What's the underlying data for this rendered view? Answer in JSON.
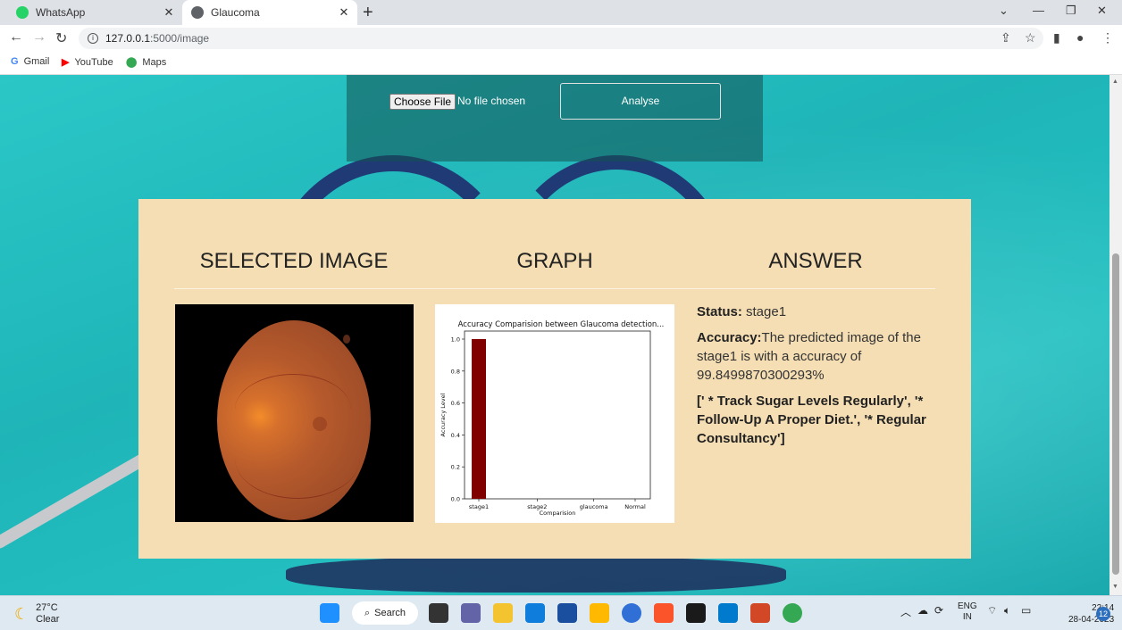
{
  "browser": {
    "tabs": [
      {
        "title": "WhatsApp",
        "icon": "whatsapp-icon",
        "active": false
      },
      {
        "title": "Glaucoma",
        "icon": "globe-icon",
        "active": true
      }
    ],
    "url_host": "127.0.0.1",
    "url_path": ":5000/image",
    "bookmarks": [
      {
        "label": "Gmail",
        "icon": "gmail-icon"
      },
      {
        "label": "YouTube",
        "icon": "youtube-icon"
      },
      {
        "label": "Maps",
        "icon": "maps-icon"
      }
    ]
  },
  "upload": {
    "choose_label": "Choose File",
    "file_status": "No file chosen",
    "analyse_label": "Analyse"
  },
  "results": {
    "col1_heading": "SELECTED IMAGE",
    "col2_heading": "GRAPH",
    "col3_heading": "ANSWER",
    "status_label": "Status:",
    "status_value": "stage1",
    "accuracy_label": "Accuracy:",
    "accuracy_text": "The predicted image of the stage1 is with a accuracy of 99.8499870300293%",
    "advice": "[' * Track Sugar Levels Regularly', '* Follow-Up A Proper Diet.', '* Regular Consultancy']"
  },
  "chart_data": {
    "type": "bar",
    "title": "Accuracy Comparision between Glaucoma detection...",
    "xlabel": "Comparision",
    "ylabel": "Accuracy Level",
    "categories": [
      "stage1",
      "stage2",
      "glaucoma",
      "Normal"
    ],
    "values": [
      1.0,
      0,
      0,
      0
    ],
    "ylim": [
      0,
      1.0
    ],
    "yticks": [
      0.0,
      0.2,
      0.4,
      0.6,
      0.8,
      1.0
    ],
    "bar_color": "#800000"
  },
  "taskbar": {
    "temperature": "27°C",
    "weather": "Clear",
    "search_label": "Search",
    "lang_top": "ENG",
    "lang_bottom": "IN",
    "time": "22:14",
    "date": "28-04-2023",
    "notification_count": "12"
  }
}
